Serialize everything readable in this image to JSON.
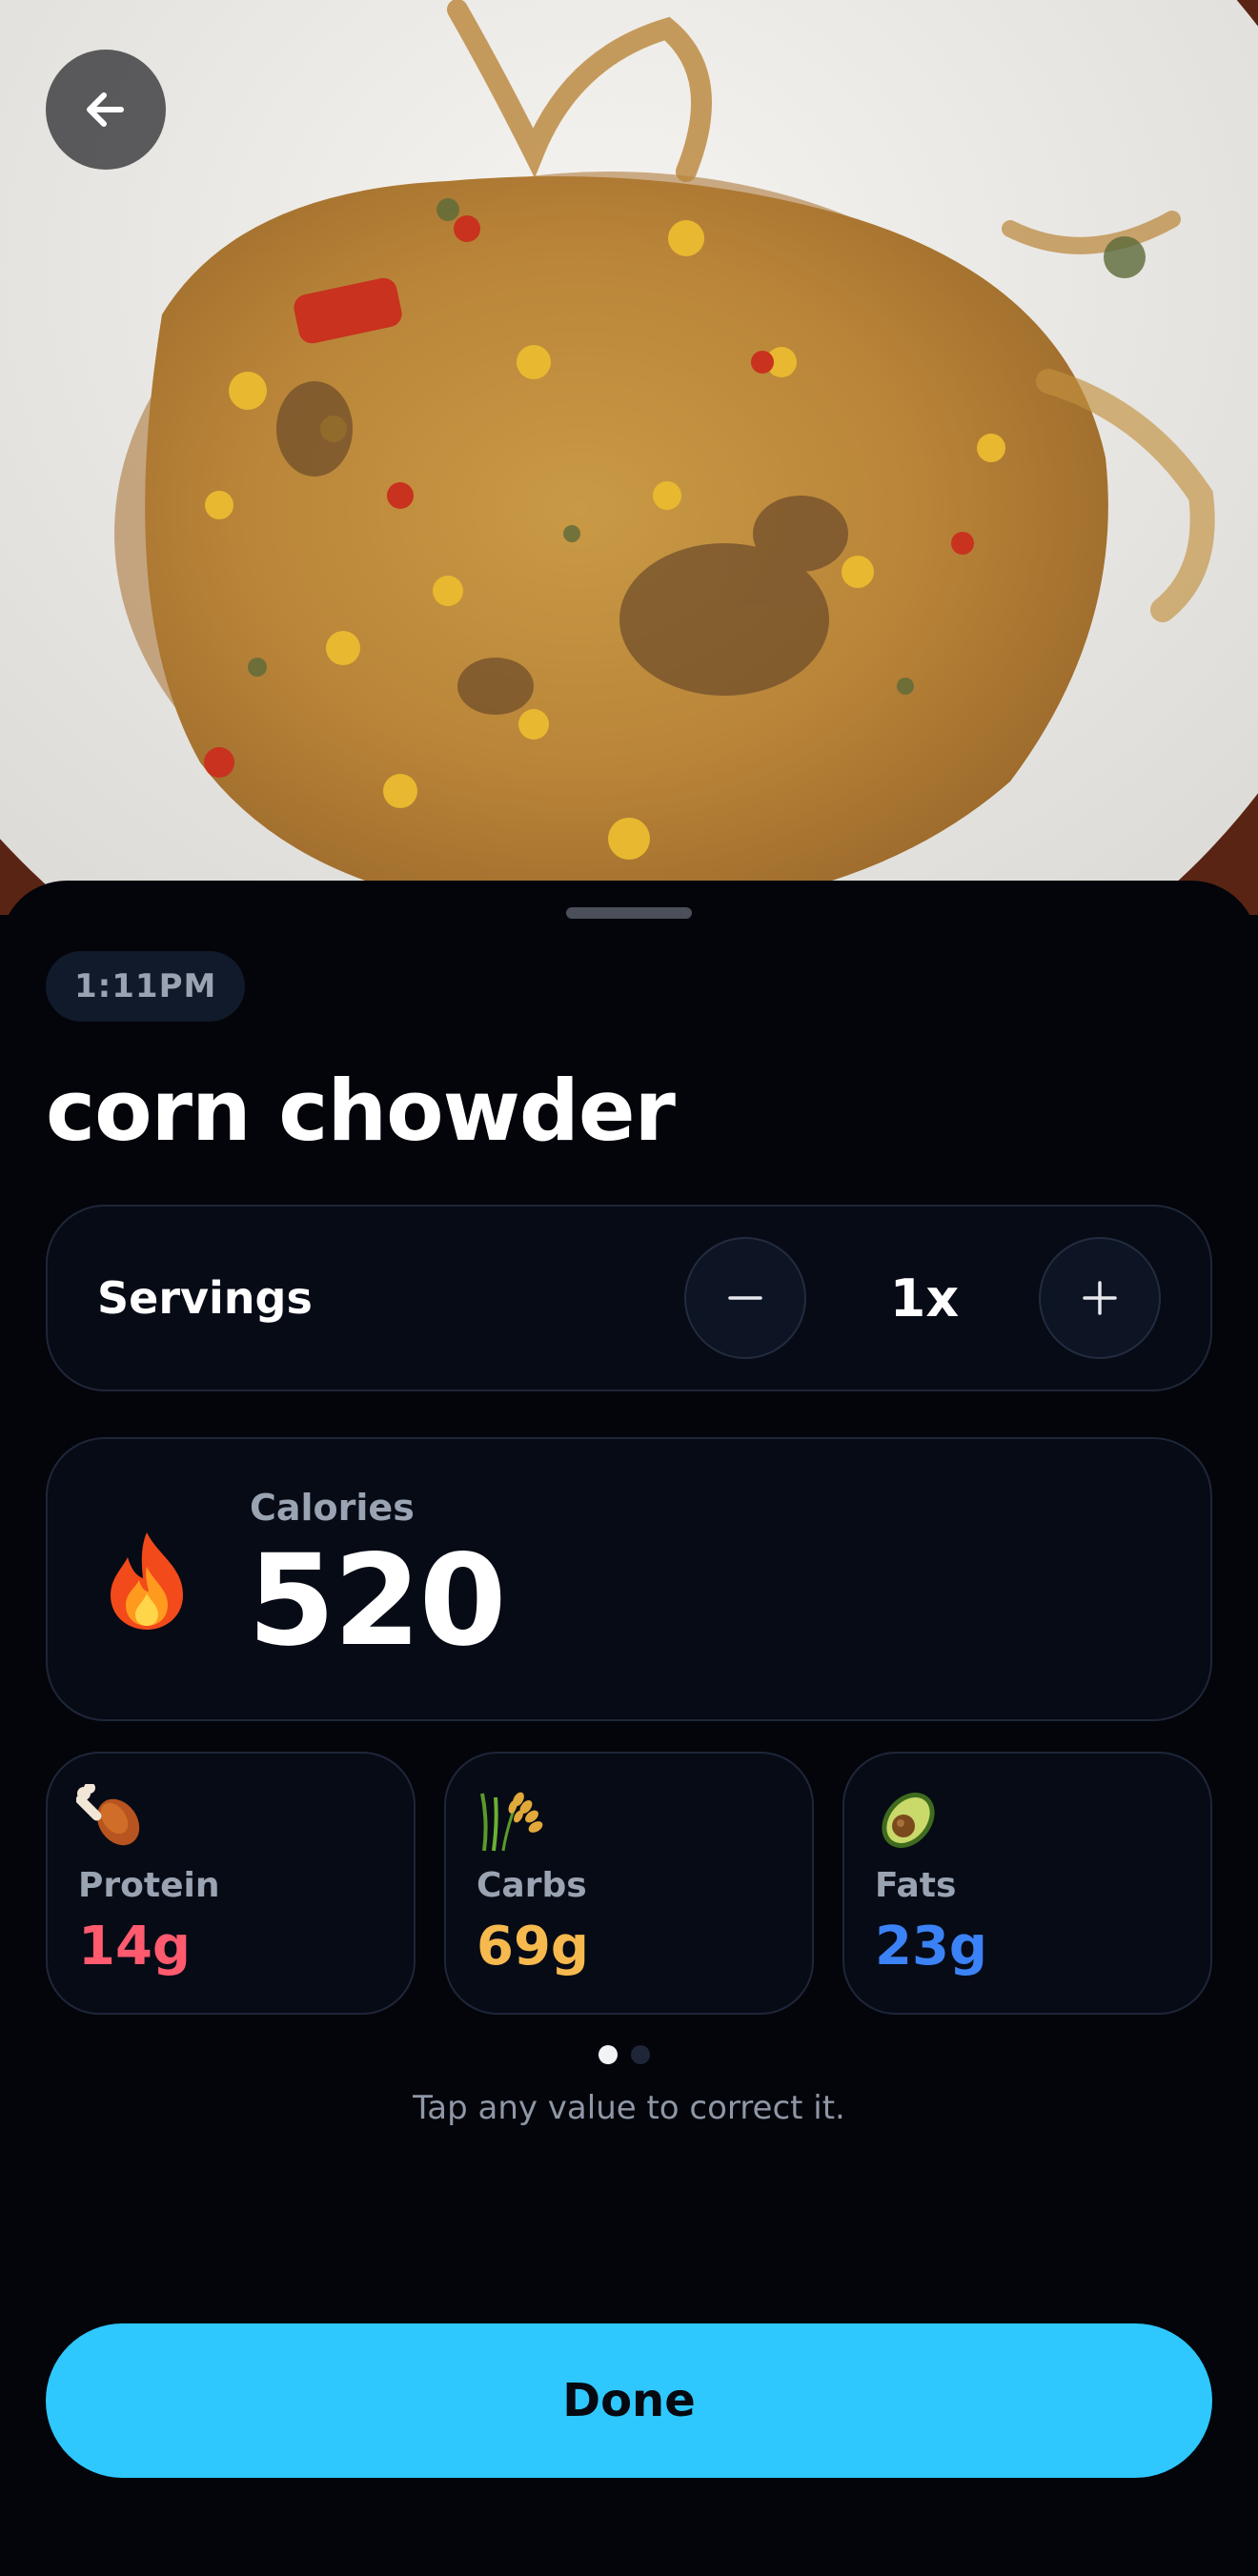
{
  "header": {
    "back_icon": "arrow-left-icon",
    "photo_description_icon": "food-photo"
  },
  "meal": {
    "time": "1:11PM",
    "name": "corn chowder"
  },
  "servings": {
    "label": "Servings",
    "value": "1x",
    "decrement_icon": "minus-icon",
    "increment_icon": "plus-icon"
  },
  "calories": {
    "label": "Calories",
    "value": "520",
    "icon": "fire-icon"
  },
  "macros": {
    "protein": {
      "label": "Protein",
      "value": "14g",
      "icon": "drumstick-icon",
      "color": "#ff5a6e"
    },
    "carbs": {
      "label": "Carbs",
      "value": "69g",
      "icon": "grain-icon",
      "color": "#f6b94e"
    },
    "fats": {
      "label": "Fats",
      "value": "23g",
      "icon": "avocado-icon",
      "color": "#3b82f6"
    }
  },
  "pager": {
    "pages": 2,
    "active": 1
  },
  "hint": "Tap any value to correct it.",
  "actions": {
    "done_label": "Done"
  },
  "colors": {
    "accent": "#2ec8ff",
    "background": "#03050b",
    "card": "#070b16"
  }
}
